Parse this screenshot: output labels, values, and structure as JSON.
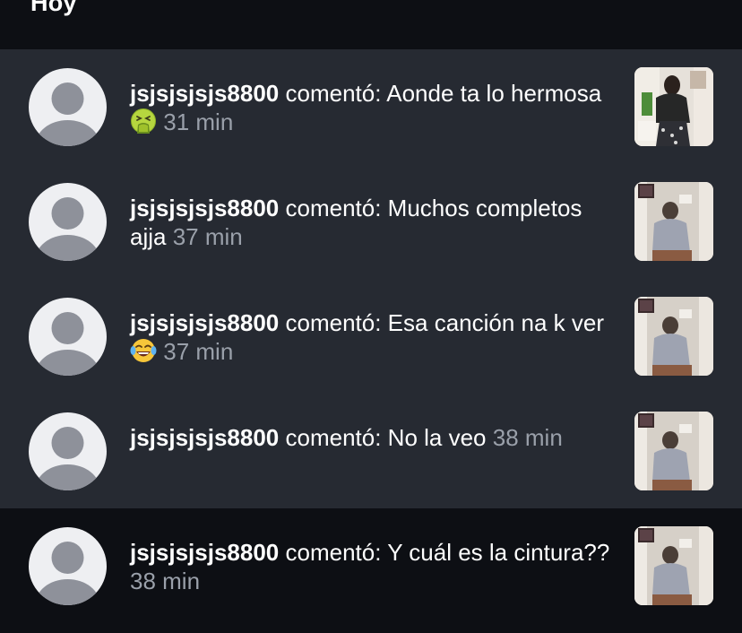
{
  "header": {
    "title": "Hoy"
  },
  "notifications": [
    {
      "username": "jsjsjsjsjs8800",
      "action": " comentó: ",
      "comment": "Aonde ta lo hermosa",
      "emoji": "vomiting-face-emoji",
      "time": "31 min"
    },
    {
      "username": "jsjsjsjsjs8800",
      "action": " comentó: ",
      "comment": "Muchos completos ajja",
      "emoji": "",
      "time": "37 min"
    },
    {
      "username": "jsjsjsjsjs8800",
      "action": " comentó: ",
      "comment": "Esa canción na k ver",
      "emoji": "laughing-tears-emoji",
      "time": "37 min"
    },
    {
      "username": "jsjsjsjsjs8800",
      "action": " comentó: ",
      "comment": "No la veo",
      "emoji": "",
      "time": "38 min"
    },
    {
      "username": "jsjsjsjsjs8800",
      "action": " comentó: ",
      "comment": "Y cuál es la cintura??",
      "emoji": "",
      "time": "38 min"
    }
  ],
  "colors": {
    "unread_background": "#262a32",
    "read_background": "#0d0f14",
    "timestamp": "#9aa0aa",
    "avatar_background": "#eeeff2",
    "avatar_silhouette": "#8e919a"
  }
}
